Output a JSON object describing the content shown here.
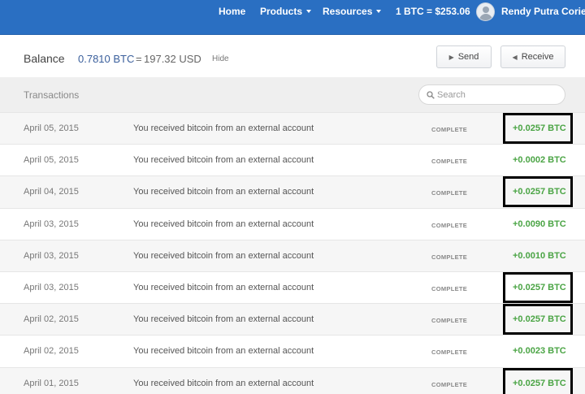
{
  "nav": {
    "home": "Home",
    "products": "Products",
    "resources": "Resources",
    "btc_rate": "1 BTC = $253.06",
    "user_name": "Rendy Putra Corie"
  },
  "balance": {
    "label": "Balance",
    "btc": "0.7810 BTC",
    "equals": "=",
    "usd": "197.32 USD",
    "hide": "Hide"
  },
  "actions": {
    "send": "Send",
    "receive": "Receive"
  },
  "transactions": {
    "title": "Transactions",
    "search_placeholder": "Search",
    "rows": [
      {
        "date": "April 05, 2015",
        "description": "You received bitcoin from an external account",
        "status": "COMPLETE",
        "amount": "+0.0257 BTC",
        "highlighted": true
      },
      {
        "date": "April 05, 2015",
        "description": "You received bitcoin from an external account",
        "status": "COMPLETE",
        "amount": "+0.0002 BTC",
        "highlighted": false
      },
      {
        "date": "April 04, 2015",
        "description": "You received bitcoin from an external account",
        "status": "COMPLETE",
        "amount": "+0.0257 BTC",
        "highlighted": true
      },
      {
        "date": "April 03, 2015",
        "description": "You received bitcoin from an external account",
        "status": "COMPLETE",
        "amount": "+0.0090 BTC",
        "highlighted": false
      },
      {
        "date": "April 03, 2015",
        "description": "You received bitcoin from an external account",
        "status": "COMPLETE",
        "amount": "+0.0010 BTC",
        "highlighted": false
      },
      {
        "date": "April 03, 2015",
        "description": "You received bitcoin from an external account",
        "status": "COMPLETE",
        "amount": "+0.0257 BTC",
        "highlighted": true
      },
      {
        "date": "April 02, 2015",
        "description": "You received bitcoin from an external account",
        "status": "COMPLETE",
        "amount": "+0.0257 BTC",
        "highlighted": true
      },
      {
        "date": "April 02, 2015",
        "description": "You received bitcoin from an external account",
        "status": "COMPLETE",
        "amount": "+0.0023 BTC",
        "highlighted": false
      },
      {
        "date": "April 01, 2015",
        "description": "You received bitcoin from an external account",
        "status": "COMPLETE",
        "amount": "+0.0257 BTC",
        "highlighted": true
      }
    ]
  },
  "colors": {
    "nav_bg": "#2a6fc2",
    "amount_positive": "#4aa444",
    "highlight_border": "#000000"
  }
}
